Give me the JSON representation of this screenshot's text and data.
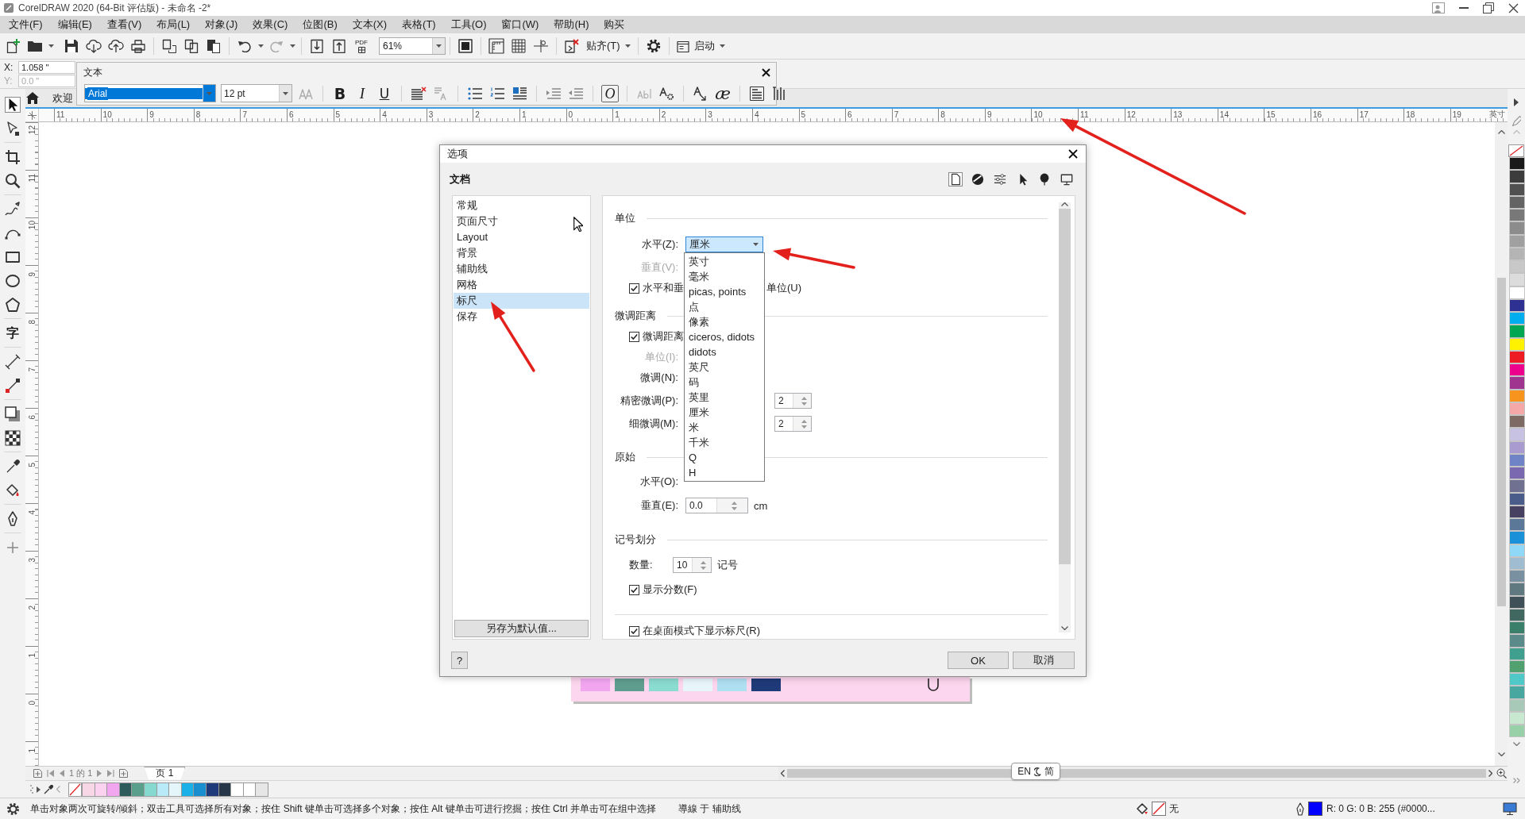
{
  "window": {
    "title": "CorelDRAW 2020 (64-Bit 评估版) - 未命名 -2*"
  },
  "menu": [
    "文件(F)",
    "编辑(E)",
    "查看(V)",
    "布局(L)",
    "对象(J)",
    "效果(C)",
    "位图(B)",
    "文本(X)",
    "表格(T)",
    "工具(O)",
    "窗口(W)",
    "帮助(H)",
    "购买"
  ],
  "toolbar": {
    "pdf": "PDF",
    "zoom": "61%",
    "snap": "贴齐(T)",
    "launch": "启动"
  },
  "property_bar": {
    "x_label": "X:",
    "x_value": "1.058 \"",
    "y_label": "Y:",
    "y_value": "0.0 \"",
    "y_disabled": true
  },
  "text_toolbar": {
    "title": "文本",
    "font": "Arial",
    "font_selected": true,
    "size": "12 pt",
    "bold": "B",
    "italic": "I",
    "underline": "U",
    "opentype": "O",
    "glyph": "æ"
  },
  "doc_tab": "欢迎",
  "tools": [
    {
      "selected": true
    },
    {
      "selected": false
    },
    {
      "selected": false
    },
    {
      "selected": false
    },
    {
      "selected": false
    },
    {
      "selected": false
    },
    {
      "selected": false
    },
    {
      "selected": false
    },
    {
      "selected": false
    },
    {
      "label": "字",
      "selected": false
    },
    {
      "selected": false
    },
    {
      "selected": false
    },
    {
      "selected": false
    },
    {
      "selected": false
    },
    {
      "selected": false
    },
    {
      "selected": false
    },
    {
      "selected": false
    },
    {
      "selected": false
    }
  ],
  "ruler": {
    "labels": [
      "11",
      "10",
      "9",
      "8",
      "7",
      "6",
      "5",
      "4",
      "3",
      "2",
      "1",
      "0",
      "1",
      "2",
      "3",
      "4",
      "5",
      "6",
      "7",
      "8",
      "9",
      "10",
      "11",
      "12",
      "13",
      "14",
      "15",
      "16",
      "17",
      "18",
      "19"
    ],
    "unit": "英寸",
    "vertical_labels": [
      "12",
      "11",
      "10",
      "9",
      "8",
      "7",
      "6",
      "5",
      "4",
      "3",
      "2",
      "1",
      "0",
      "1"
    ]
  },
  "canvas": {
    "artwork_tiles": [
      {
        "color": "#f2a6f0"
      },
      {
        "color": "#5f9e8f"
      },
      {
        "color": "#8adbd0"
      },
      {
        "color": "#e8f5fb"
      },
      {
        "color": "#aee0f2"
      },
      {
        "color": "#1e3a78"
      }
    ]
  },
  "dialog": {
    "title": "选项",
    "section": "文档",
    "tool_tabs": [
      {
        "selected": true
      },
      {
        "selected": false
      },
      {
        "selected": false
      },
      {
        "selected": false
      },
      {
        "selected": false
      },
      {
        "selected": false
      }
    ],
    "categories": [
      {
        "label": "常规",
        "selected": false
      },
      {
        "label": "页面尺寸",
        "selected": false
      },
      {
        "label": "Layout",
        "selected": false
      },
      {
        "label": "背景",
        "selected": false
      },
      {
        "label": "辅助线",
        "selected": false
      },
      {
        "label": "网格",
        "selected": false
      },
      {
        "label": "标尺",
        "selected": true
      },
      {
        "label": "保存",
        "selected": false
      }
    ],
    "save_default": "另存为默认值...",
    "units": {
      "heading": "单位",
      "horizontal_label": "水平(Z):",
      "horizontal_value": "厘米",
      "vertical_label": "垂直(V):",
      "vertical_disabled": true,
      "same_units": {
        "label_start": "水平和垂",
        "label_end": "单位(U)",
        "checked": true
      }
    },
    "unit_options": [
      {
        "label": "英寸",
        "selected": false
      },
      {
        "label": "毫米",
        "selected": false
      },
      {
        "label": "picas, points",
        "selected": false
      },
      {
        "label": "点",
        "selected": false
      },
      {
        "label": "像素",
        "selected": false
      },
      {
        "label": "ciceros, didots",
        "selected": false
      },
      {
        "label": "didots",
        "selected": false
      },
      {
        "label": "英尺",
        "selected": false
      },
      {
        "label": "码",
        "selected": false
      },
      {
        "label": "英里",
        "selected": false
      },
      {
        "label": "厘米",
        "selected": false
      },
      {
        "label": "米",
        "selected": false
      },
      {
        "label": "千米",
        "selected": false
      },
      {
        "label": "Q",
        "selected": false
      },
      {
        "label": "H",
        "selected": false
      }
    ],
    "nudge": {
      "heading": "微调距离",
      "enable": {
        "label": "微调距离",
        "checked": true
      },
      "unit_label": "单位(I):",
      "unit_disabled": true,
      "nudge_label": "微调(N):",
      "super_label": "精密微调(P):",
      "super_value": "2",
      "micro_label": "细微调(M):",
      "micro_value": "2"
    },
    "origin": {
      "heading": "原始",
      "horizontal_label": "水平(O):",
      "vertical_label": "垂直(E):",
      "vertical_value": "0.0",
      "vertical_unit": "cm"
    },
    "tick_divisions": {
      "heading": "记号划分",
      "count_label": "数量:",
      "count_value": "10",
      "count_unit": "记号",
      "show_fractions": {
        "label": "显示分数(F)",
        "checked": true
      }
    },
    "desktop_rulers": {
      "label": "在桌面模式下显示标尺(R)",
      "checked": true
    },
    "help": "?",
    "ok": "OK",
    "cancel": "取消"
  },
  "page_nav": {
    "position": "1 的 1",
    "tab": "页 1"
  },
  "ime": {
    "language": "EN",
    "mode": "简"
  },
  "bottom_palette": [
    {
      "kind": "none"
    },
    {
      "kind": "color",
      "color": "#f7d7e6"
    },
    {
      "kind": "color",
      "color": "#fbd3f0"
    },
    {
      "kind": "color",
      "color": "#f2a6f0"
    },
    {
      "kind": "color",
      "color": "#2e5c5c"
    },
    {
      "kind": "color",
      "color": "#5a9e8c"
    },
    {
      "kind": "color",
      "color": "#86d9cf"
    },
    {
      "kind": "color",
      "color": "#b8eaf7"
    },
    {
      "kind": "color",
      "color": "#e4f6fa"
    },
    {
      "kind": "color",
      "color": "#1ab0e8"
    },
    {
      "kind": "color",
      "color": "#1a8fd0"
    },
    {
      "kind": "color",
      "color": "#1e3a7a"
    },
    {
      "kind": "color",
      "color": "#263548"
    },
    {
      "kind": "color",
      "color": "#ffffff"
    },
    {
      "kind": "color",
      "color": "#ffffff"
    },
    {
      "kind": "color",
      "color": "#e6e6e6"
    }
  ],
  "side_palette": [
    {
      "kind": "none"
    },
    {
      "kind": "color",
      "color": "#1a1a1a"
    },
    {
      "kind": "color",
      "color": "#3c3c3c"
    },
    {
      "kind": "color",
      "color": "#505050"
    },
    {
      "kind": "color",
      "color": "#646464"
    },
    {
      "kind": "color",
      "color": "#787878"
    },
    {
      "kind": "color",
      "color": "#8c8c8c"
    },
    {
      "kind": "color",
      "color": "#a0a0a0"
    },
    {
      "kind": "color",
      "color": "#b4b4b4"
    },
    {
      "kind": "color",
      "color": "#c8c8c8"
    },
    {
      "kind": "color",
      "color": "#dcdcdc"
    },
    {
      "kind": "color",
      "color": "#ffffff"
    },
    {
      "kind": "color",
      "color": "#2e3192"
    },
    {
      "kind": "color",
      "color": "#00aeef"
    },
    {
      "kind": "color",
      "color": "#00a651"
    },
    {
      "kind": "color",
      "color": "#fff200"
    },
    {
      "kind": "color",
      "color": "#ed1c24"
    },
    {
      "kind": "color",
      "color": "#ec008c"
    },
    {
      "kind": "color",
      "color": "#a0358f"
    },
    {
      "kind": "color",
      "color": "#f7941d"
    },
    {
      "kind": "color",
      "color": "#f5a8a8"
    },
    {
      "kind": "color",
      "color": "#7d6b63"
    },
    {
      "kind": "color",
      "color": "#c8c2e2"
    },
    {
      "kind": "color",
      "color": "#a99bd0"
    },
    {
      "kind": "color",
      "color": "#6f83c6"
    },
    {
      "kind": "color",
      "color": "#7a68b0"
    },
    {
      "kind": "color",
      "color": "#707090"
    },
    {
      "kind": "color",
      "color": "#4a5c8a"
    },
    {
      "kind": "color",
      "color": "#484060"
    },
    {
      "kind": "color",
      "color": "#5c7898"
    },
    {
      "kind": "color",
      "color": "#1a90d8"
    },
    {
      "kind": "color",
      "color": "#8fd8f8"
    },
    {
      "kind": "color",
      "color": "#a0bcd0"
    },
    {
      "kind": "color",
      "color": "#7890a0"
    },
    {
      "kind": "color",
      "color": "#607880"
    },
    {
      "kind": "color",
      "color": "#405058"
    },
    {
      "kind": "color",
      "color": "#406860"
    },
    {
      "kind": "color",
      "color": "#3a7f6a"
    },
    {
      "kind": "color",
      "color": "#5a8a8a"
    },
    {
      "kind": "color",
      "color": "#40a090"
    },
    {
      "kind": "color",
      "color": "#50a070"
    },
    {
      "kind": "color",
      "color": "#50c8c8"
    },
    {
      "kind": "color",
      "color": "#48a8a0"
    },
    {
      "kind": "color",
      "color": "#a8c8b8"
    },
    {
      "kind": "color",
      "color": "#c8e8d0"
    },
    {
      "kind": "color",
      "color": "#98d0a8"
    }
  ],
  "status_bar": {
    "hint": "单击对象两次可旋转/倾斜；双击工具可选择所有对象；按住 Shift 键单击可选择多个对象；按住 Alt 键单击可进行挖掘；按住 Ctrl 并单击可在组中选择",
    "snap": "導線 于 辅助线",
    "fill": "无",
    "outline": "R: 0 G: 0 B: 255 (#0000...",
    "outline_swatch": {
      "color": "#0000ff"
    }
  }
}
